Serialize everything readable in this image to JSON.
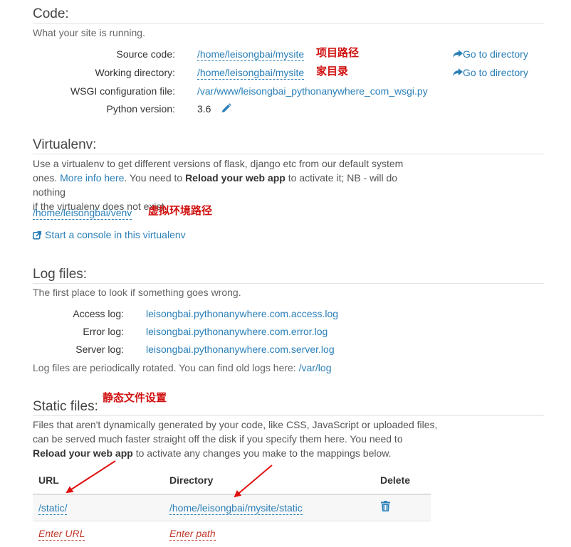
{
  "code": {
    "title": "Code:",
    "subtitle": "What your site is running.",
    "rows": [
      {
        "label": "Source code:",
        "value": "/home/leisongbai/mysite",
        "annotation": "项目路径",
        "action": "Go to directory"
      },
      {
        "label": "Working directory:",
        "value": "/home/leisongbai/mysite",
        "annotation": "家目录",
        "action": "Go to directory"
      },
      {
        "label": "WSGI configuration file:",
        "value": "/var/www/leisongbai_pythonanywhere_com_wsgi.py"
      },
      {
        "label": "Python version:",
        "value": "3.6"
      }
    ]
  },
  "virtualenv": {
    "title": "Virtualenv:",
    "desc_line1": "Use a virtualenv to get different versions of flask, django etc from our default system",
    "desc_l2_pre": "ones. ",
    "desc_l2_link": "More info here",
    "desc_l2_mid": ". You need to ",
    "desc_l2_bold": "Reload your web app",
    "desc_l2_post": " to activate it; NB - will do nothing",
    "desc_line3": "if the virtualenv does not exist.",
    "path": "/home/leisongbai/venv",
    "annotation": "虚拟环境路径",
    "console_link": "Start a console in this virtualenv"
  },
  "logs": {
    "title": "Log files:",
    "subtitle": "The first place to look if something goes wrong.",
    "rows": [
      {
        "label": "Access log:",
        "value": "leisongbai.pythonanywhere.com.access.log"
      },
      {
        "label": "Error log:",
        "value": "leisongbai.pythonanywhere.com.error.log"
      },
      {
        "label": "Server log:",
        "value": "leisongbai.pythonanywhere.com.server.log"
      }
    ],
    "footer_pre": "Log files are periodically rotated. You can find old logs here: ",
    "footer_link": "/var/log"
  },
  "static": {
    "title": "Static files:",
    "annotation": "静态文件设置",
    "desc_line1": "Files that aren't dynamically generated by your code, like CSS, JavaScript or uploaded files,",
    "desc_line2": "can be served much faster straight off the disk if you specify them here. You need to",
    "desc_l3_bold": "Reload your web app",
    "desc_l3_post": " to activate any changes you make to the mappings below.",
    "headers": {
      "url": "URL",
      "directory": "Directory",
      "delete": "Delete"
    },
    "rows": [
      {
        "url": "/static/",
        "directory": "/home/leisongbai/mysite/static"
      }
    ],
    "new_row": {
      "url_placeholder": "Enter URL",
      "path_placeholder": "Enter path"
    }
  },
  "colors": {
    "link": "#2a7fb8",
    "annotation": "#d01010",
    "placeholder": "#c0392b"
  }
}
